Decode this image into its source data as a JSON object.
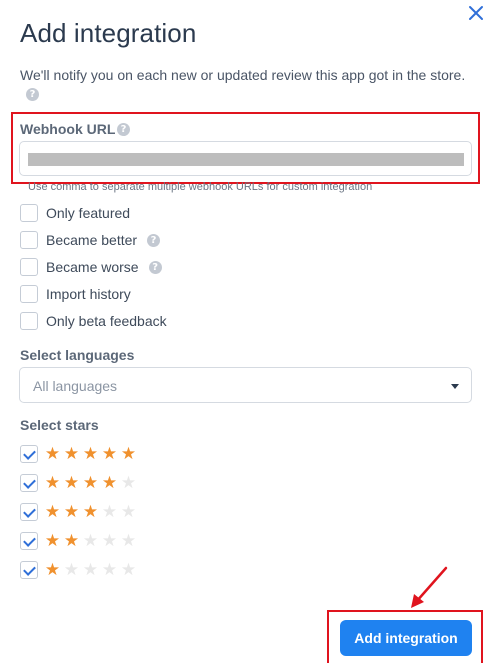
{
  "dialog": {
    "title": "Add integration",
    "description": "We'll notify you on each new or updated review this app got in the store.",
    "help_glyph": "?"
  },
  "webhook": {
    "label": "Webhook URL",
    "value": "",
    "hint": "Use comma to separate multiple webhook URLs for custom integration"
  },
  "options": [
    {
      "label": "Only featured",
      "checked": false,
      "has_help": false
    },
    {
      "label": "Became better",
      "checked": false,
      "has_help": true
    },
    {
      "label": "Became worse",
      "checked": false,
      "has_help": true
    },
    {
      "label": "Import history",
      "checked": false,
      "has_help": false
    },
    {
      "label": "Only beta feedback",
      "checked": false,
      "has_help": false
    }
  ],
  "languages": {
    "label": "Select languages",
    "selected": "All languages"
  },
  "stars": {
    "label": "Select stars",
    "rows": [
      {
        "stars": 5,
        "checked": true
      },
      {
        "stars": 4,
        "checked": true
      },
      {
        "stars": 3,
        "checked": true
      },
      {
        "stars": 2,
        "checked": true
      },
      {
        "stars": 1,
        "checked": true
      }
    ],
    "star_glyph": "★"
  },
  "submit": {
    "label": "Add integration"
  },
  "colors": {
    "accent": "#1f82f0",
    "star": "#f0912e",
    "highlight": "#e0141e"
  }
}
